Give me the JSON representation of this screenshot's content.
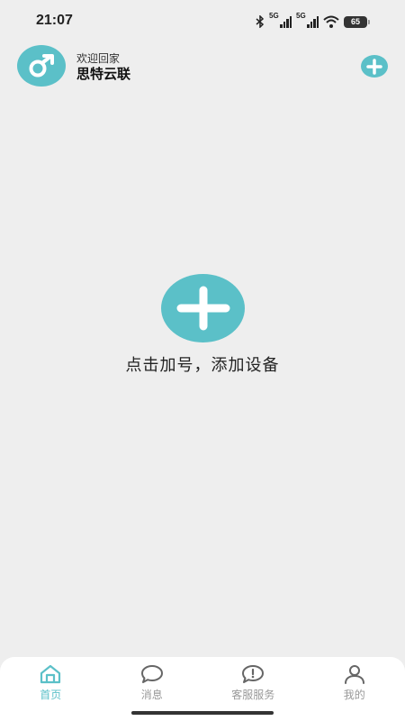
{
  "status_bar": {
    "time": "21:07",
    "network_1": "5G",
    "network_2": "5G",
    "battery": "65"
  },
  "header": {
    "welcome": "欢迎回家",
    "user_name": "思特云联"
  },
  "main": {
    "hint": "点击加号，添加设备"
  },
  "tabs": [
    {
      "label": "首页",
      "icon": "home-icon",
      "active": true
    },
    {
      "label": "消息",
      "icon": "chat-bubble-icon",
      "active": false
    },
    {
      "label": "客服服务",
      "icon": "alert-bubble-icon",
      "active": false
    },
    {
      "label": "我的",
      "icon": "person-icon",
      "active": false
    }
  ],
  "colors": {
    "accent": "#5bc0c8",
    "background": "#eeeeee",
    "tab_inactive": "#999999"
  }
}
